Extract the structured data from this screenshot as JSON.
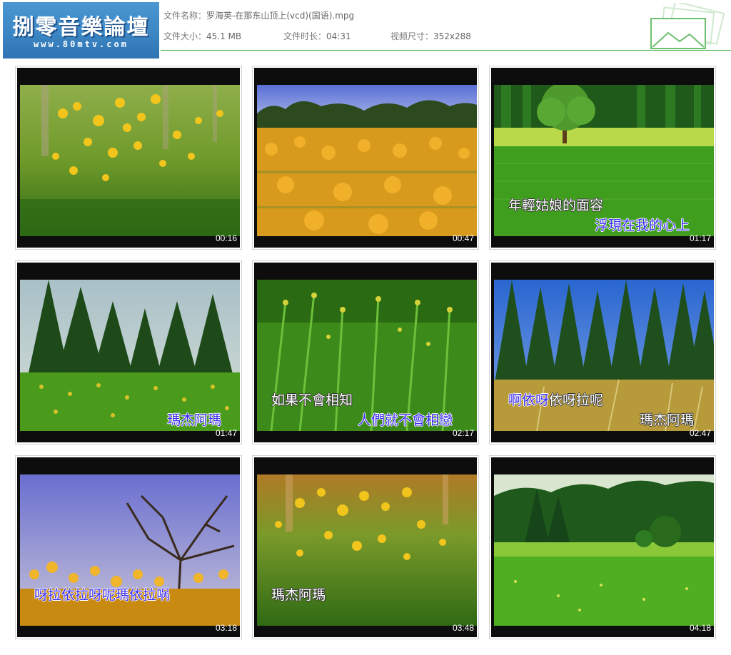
{
  "logo": {
    "title": "捌零音樂論壇",
    "url": "www.80mtv.com"
  },
  "file_info": {
    "name_label": "文件名称：",
    "name_value": "罗海英-在那东山顶上(vcd)(国语).mpg",
    "size_label": "文件大小：",
    "size_value": "45.1 MB",
    "duration_label": "文件时长：",
    "duration_value": "04:31",
    "dimensions_label": "视频尺寸：",
    "dimensions_value": "352x288"
  },
  "colors": {
    "accent_green": "#49b24a",
    "logo_blue": "#3c86c4",
    "lyric_blue": "#3a2cf0"
  },
  "thumbnails": [
    {
      "timestamp": "00:16",
      "scene": "yellow-flowers-closeup",
      "lyrics": []
    },
    {
      "timestamp": "00:47",
      "scene": "flower-field-sky",
      "lyrics": []
    },
    {
      "timestamp": "01:17",
      "scene": "tree-tea-field",
      "lyrics": [
        "年輕姑娘的面容",
        "浮現在我的心上"
      ]
    },
    {
      "timestamp": "01:47",
      "scene": "forest-flowers",
      "lyrics": [
        "瑪杰阿瑪"
      ]
    },
    {
      "timestamp": "02:17",
      "scene": "green-flowers",
      "lyrics": [
        "如果不會相知",
        "人們就不會相戀"
      ]
    },
    {
      "timestamp": "02:47",
      "scene": "cedar-forest",
      "lyrics": [
        "啊依呀依呀拉呢",
        "瑪杰阿瑪"
      ]
    },
    {
      "timestamp": "03:18",
      "scene": "bare-tree-flowers",
      "lyrics": [
        "呀拉依拉呀呢瑪依拉㖞"
      ]
    },
    {
      "timestamp": "03:48",
      "scene": "yellow-flowers-closeup-2",
      "lyrics": [
        "瑪杰阿瑪"
      ]
    },
    {
      "timestamp": "04:18",
      "scene": "green-meadow-forest",
      "lyrics": []
    }
  ]
}
